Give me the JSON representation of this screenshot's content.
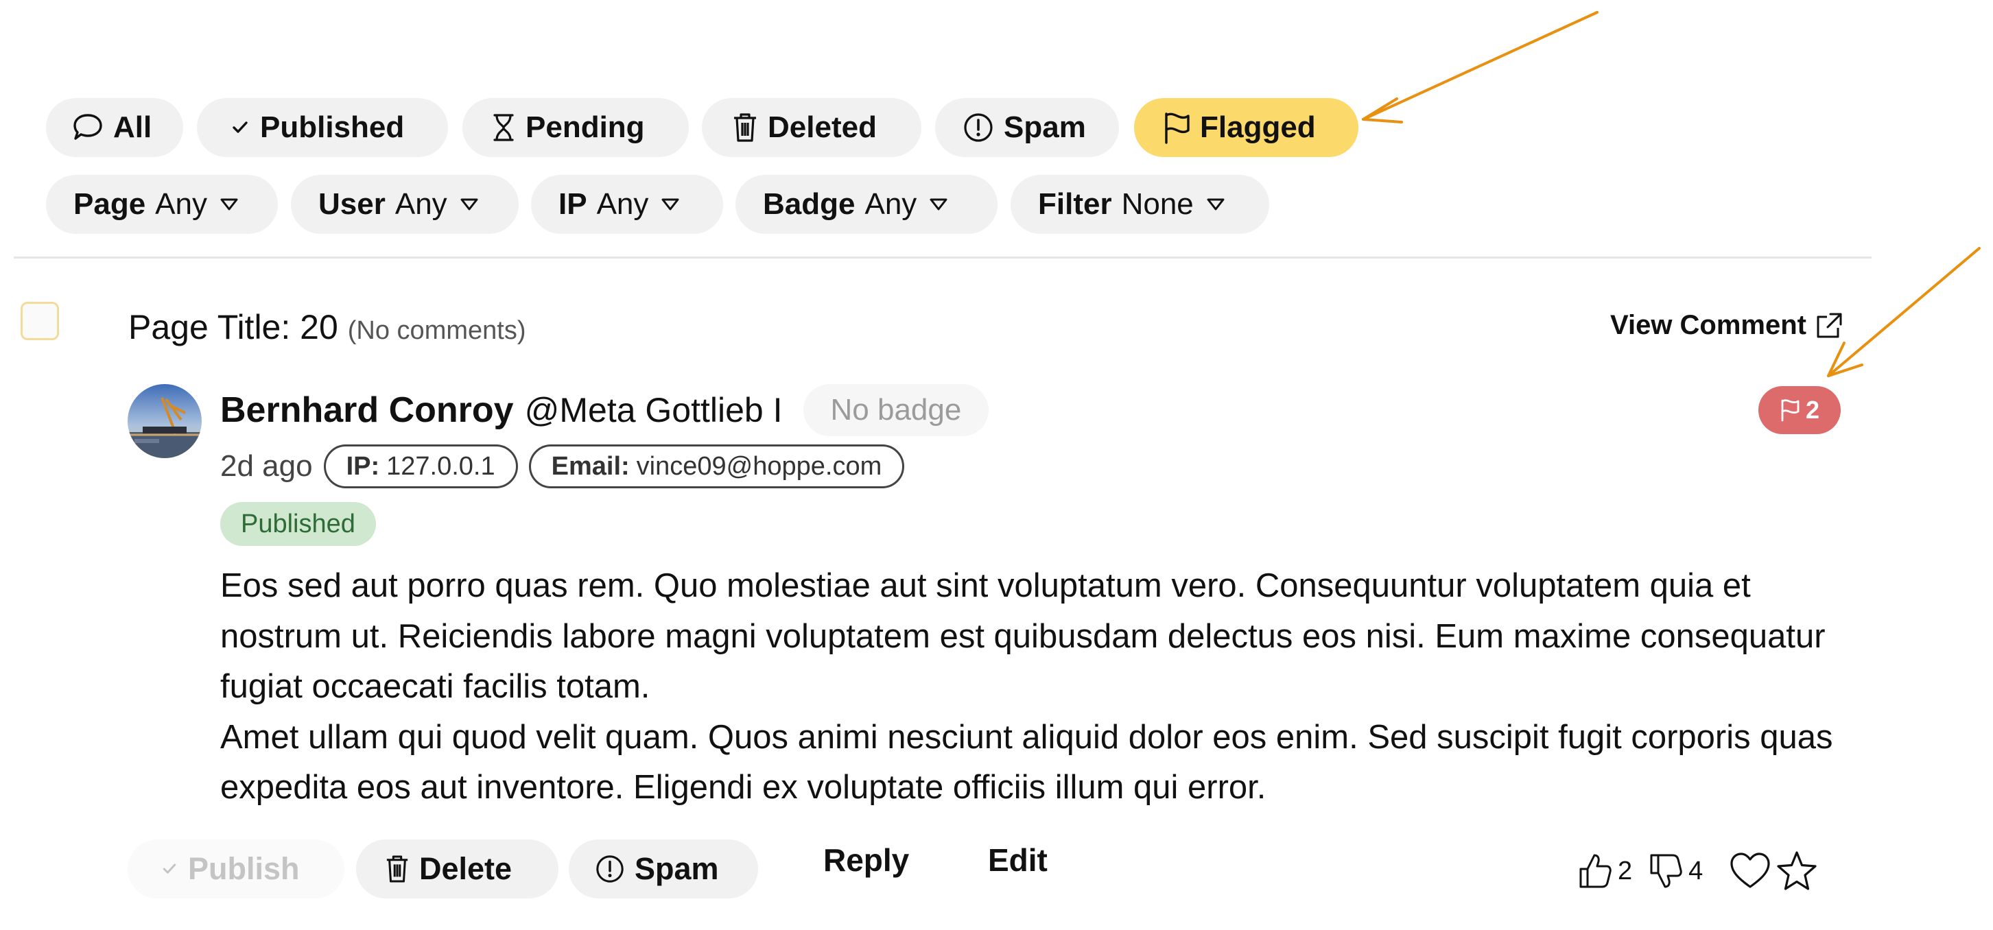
{
  "status_tabs": [
    {
      "label": "All",
      "icon": "speech-bubble-icon"
    },
    {
      "label": "Published",
      "icon": "check-icon"
    },
    {
      "label": "Pending",
      "icon": "hourglass-icon"
    },
    {
      "label": "Deleted",
      "icon": "trash-icon"
    },
    {
      "label": "Spam",
      "icon": "exclamation-circle-icon"
    },
    {
      "label": "Flagged",
      "icon": "flag-icon",
      "active": true
    }
  ],
  "filters": [
    {
      "label": "Page",
      "value": "Any"
    },
    {
      "label": "User",
      "value": "Any"
    },
    {
      "label": "IP",
      "value": "Any"
    },
    {
      "label": "Badge",
      "value": "Any"
    },
    {
      "label": "Filter",
      "value": "None"
    }
  ],
  "page_header": {
    "title": "Page Title: 20",
    "subtitle": "(No comments)",
    "view_comment_label": "View Comment"
  },
  "comment": {
    "author_name": "Bernhard Conroy",
    "author_handle": "@Meta Gottlieb I",
    "badge": "No badge",
    "flag_count": "2",
    "time_ago": "2d ago",
    "ip_label": "IP:",
    "ip": "127.0.0.1",
    "email_label": "Email:",
    "email": "vince09@hoppe.com",
    "status": "Published",
    "body": [
      "Eos sed aut porro quas rem. Quo molestiae aut sint voluptatum vero. Consequuntur voluptatem quia et nostrum ut. Reiciendis labore magni voluptatem est quibusdam delectus eos nisi. Eum maxime consequatur fugiat occaecati facilis totam.",
      "Amet ullam qui quod velit quam. Quos animi nesciunt aliquid dolor eos enim. Sed suscipit fugit corporis quas expedita eos aut inventore. Eligendi ex voluptate officiis illum qui error."
    ]
  },
  "actions": {
    "publish": "Publish",
    "delete": "Delete",
    "spam": "Spam",
    "reply": "Reply",
    "edit": "Edit",
    "upvotes": "2",
    "downvotes": "4"
  },
  "colors": {
    "flagged_active": "#fbd96a",
    "flag_count_bg": "#de6b6b",
    "published_badge_bg": "#cfe8cf",
    "published_badge_text": "#2f6b36",
    "annotation_arrow": "#e8900f"
  }
}
